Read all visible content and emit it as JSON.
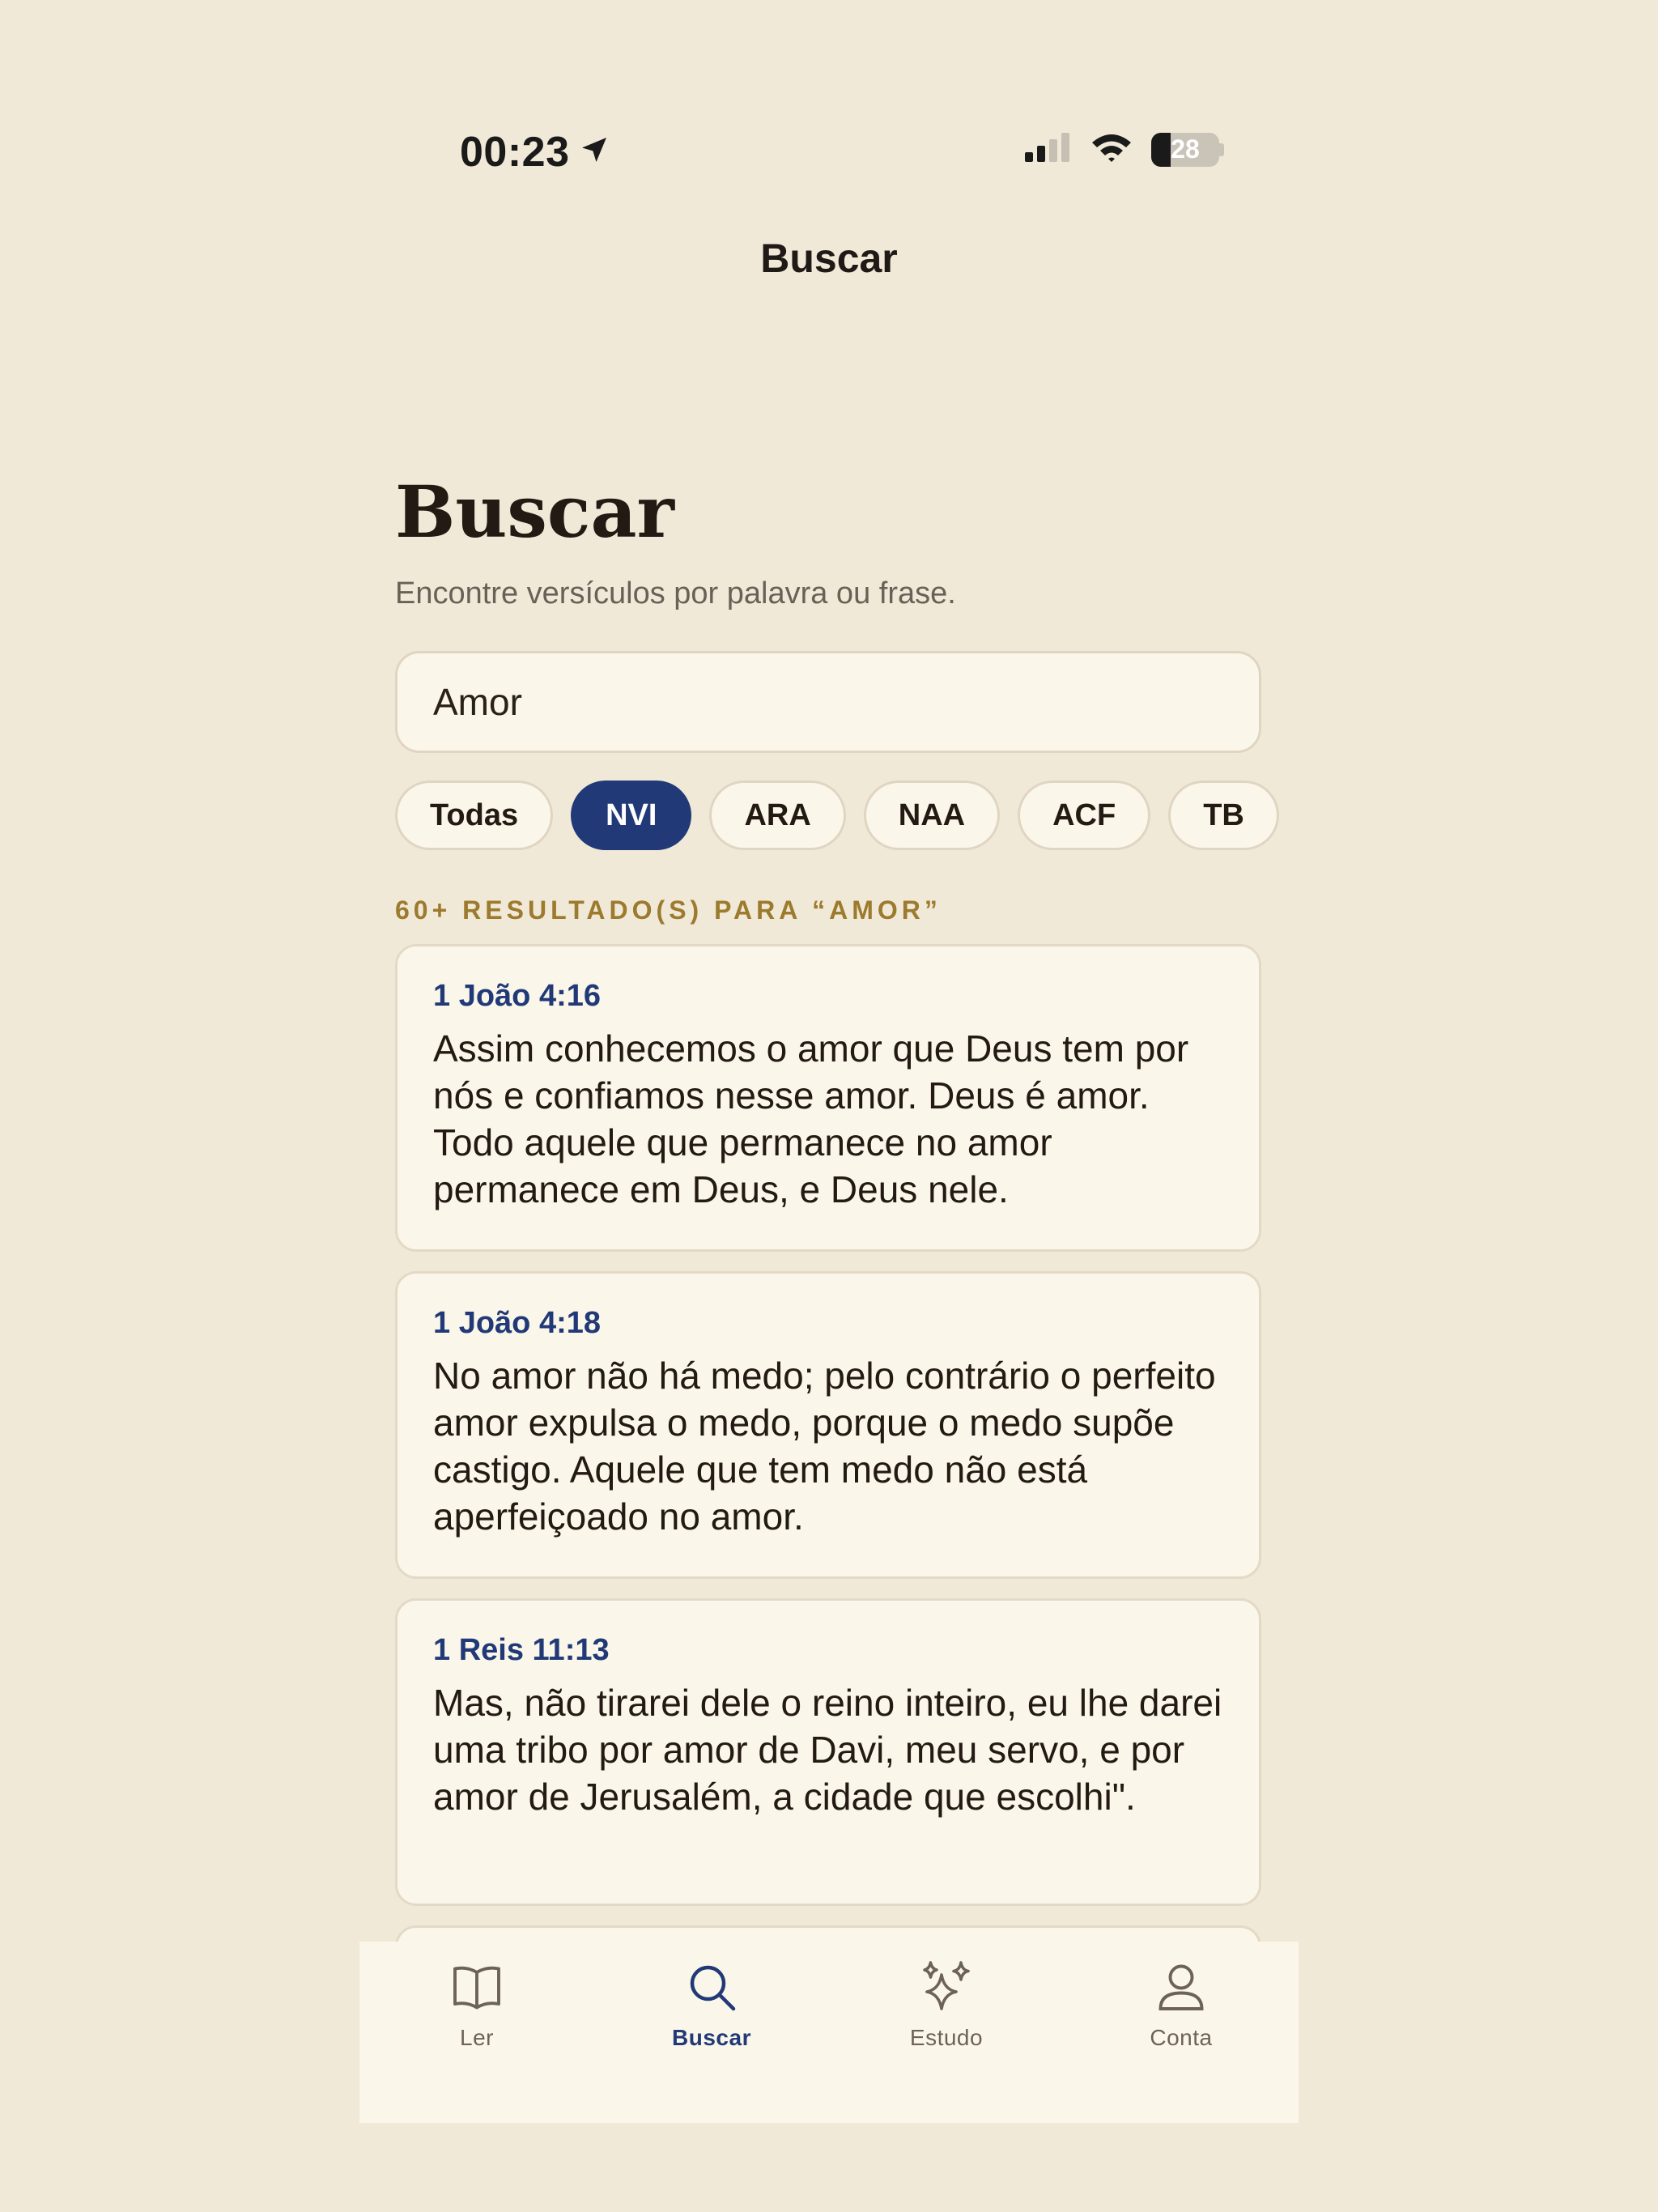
{
  "status_bar": {
    "time": "00:23",
    "battery": "28",
    "icons": [
      "location-arrow-icon",
      "cellular-signal-icon",
      "wifi-icon",
      "battery-icon"
    ]
  },
  "nav": {
    "title": "Buscar"
  },
  "main": {
    "heading": "Buscar",
    "subtitle": "Encontre versículos por palavra ou frase.",
    "search": {
      "value": "Amor",
      "placeholder": ""
    },
    "filters": [
      {
        "label": "Todas",
        "selected": false
      },
      {
        "label": "NVI",
        "selected": true
      },
      {
        "label": "ARA",
        "selected": false
      },
      {
        "label": "NAA",
        "selected": false
      },
      {
        "label": "ACF",
        "selected": false
      },
      {
        "label": "TB",
        "selected": false
      }
    ],
    "results_count": "60+ RESULTADO(S) PARA “AMOR”",
    "results": [
      {
        "reference": "1 João 4:16",
        "text": "Assim conhecemos o amor que Deus tem por nós e confiamos nesse amor. Deus é amor. Todo aquele que permanece no amor permanece em Deus, e Deus nele."
      },
      {
        "reference": "1 João 4:18",
        "text": "No amor não há medo; pelo contrário o perfeito amor expulsa o medo, porque o medo supõe castigo. Aquele que tem medo não está aperfeiçoado no amor."
      },
      {
        "reference": "1 Reis 11:13",
        "text": "Mas, não tirarei dele o reino inteiro, eu lhe darei uma tribo por amor de Davi, meu servo, e por amor de Jerusalém, a cidade que escolhi\"."
      }
    ]
  },
  "tabbar": {
    "tabs": [
      {
        "label": "Ler",
        "icon": "book-icon",
        "active": false
      },
      {
        "label": "Buscar",
        "icon": "search-icon",
        "active": true
      },
      {
        "label": "Estudo",
        "icon": "sparkles-icon",
        "active": false
      },
      {
        "label": "Conta",
        "icon": "person-icon",
        "active": false
      }
    ]
  },
  "colors": {
    "background": "#F1E9D8",
    "card": "#FBF6EA",
    "accent": "#213A77",
    "gold": "#9C7A2E"
  }
}
